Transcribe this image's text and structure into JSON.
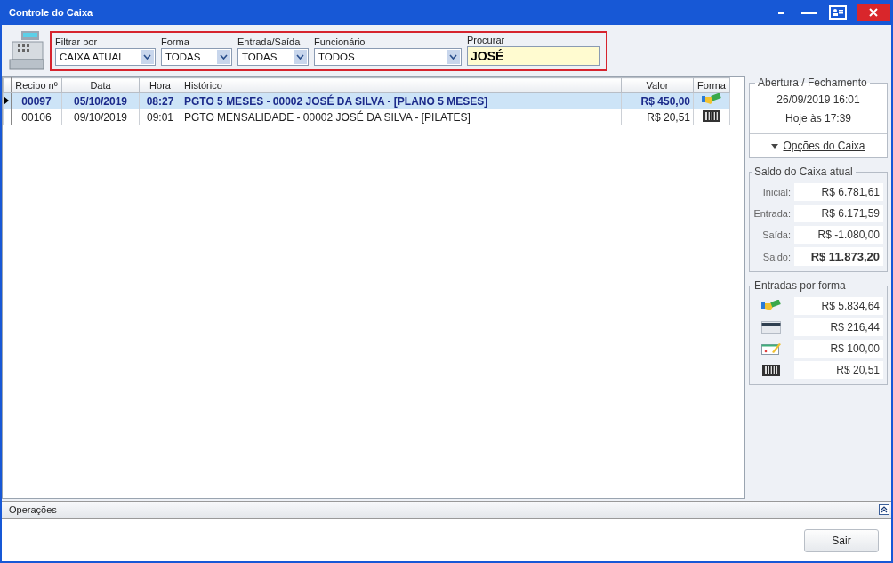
{
  "window": {
    "title": "Controle do Caixa"
  },
  "filters": [
    {
      "label": "Filtrar por",
      "value": "CAIXA ATUAL",
      "kind": "select"
    },
    {
      "label": "Forma",
      "value": "TODAS",
      "kind": "select"
    },
    {
      "label": "Entrada/Saída",
      "value": "TODAS",
      "kind": "select"
    },
    {
      "label": "Funcionário",
      "value": "TODOS",
      "kind": "select"
    },
    {
      "label": "Procurar",
      "value": "JOSÉ",
      "kind": "search"
    }
  ],
  "table": {
    "columns": [
      "Recibo nº",
      "Data",
      "Hora",
      "Histórico",
      "Valor",
      "Forma"
    ],
    "rows": [
      {
        "selected": true,
        "cells": [
          "00097",
          "05/10/2019",
          "08:27",
          "PGTO 5 MESES - 00002 JOSÉ DA SILVA - [PLANO 5 MESES]",
          "R$ 450,00"
        ],
        "kind": "cash"
      },
      {
        "selected": false,
        "cells": [
          "00106",
          "09/10/2019",
          "09:01",
          "PGTO MENSALIDADE - 00002 JOSÉ DA SILVA - [PILATES]",
          "R$ 20,51"
        ],
        "kind": "barcode"
      }
    ]
  },
  "opening_closing": {
    "title": "Abertura / Fechamento",
    "opened": "26/09/2019 16:01",
    "closed": "Hoje às 17:39",
    "options_link": "Opções do Caixa"
  },
  "balance": {
    "title": "Saldo do Caixa atual",
    "rows": [
      {
        "label": "Inicial:",
        "value": "R$ 6.781,61",
        "bold": false
      },
      {
        "label": "Entrada:",
        "value": "R$ 6.171,59",
        "bold": false
      },
      {
        "label": "Saída:",
        "value": "R$ -1.080,00",
        "bold": false
      },
      {
        "label": "Saldo:",
        "value": "R$ 11.873,20",
        "bold": true
      }
    ]
  },
  "income_by_method": {
    "title": "Entradas por forma",
    "rows": [
      {
        "kind": "cash",
        "value": "R$ 5.834,64"
      },
      {
        "kind": "card",
        "value": "R$ 216,44"
      },
      {
        "kind": "check",
        "value": "R$ 100,00"
      },
      {
        "kind": "barcode",
        "value": "R$ 20,51"
      }
    ]
  },
  "operations_panel": {
    "title": "Operações"
  },
  "buttons": [
    {
      "label": "Sair"
    }
  ]
}
